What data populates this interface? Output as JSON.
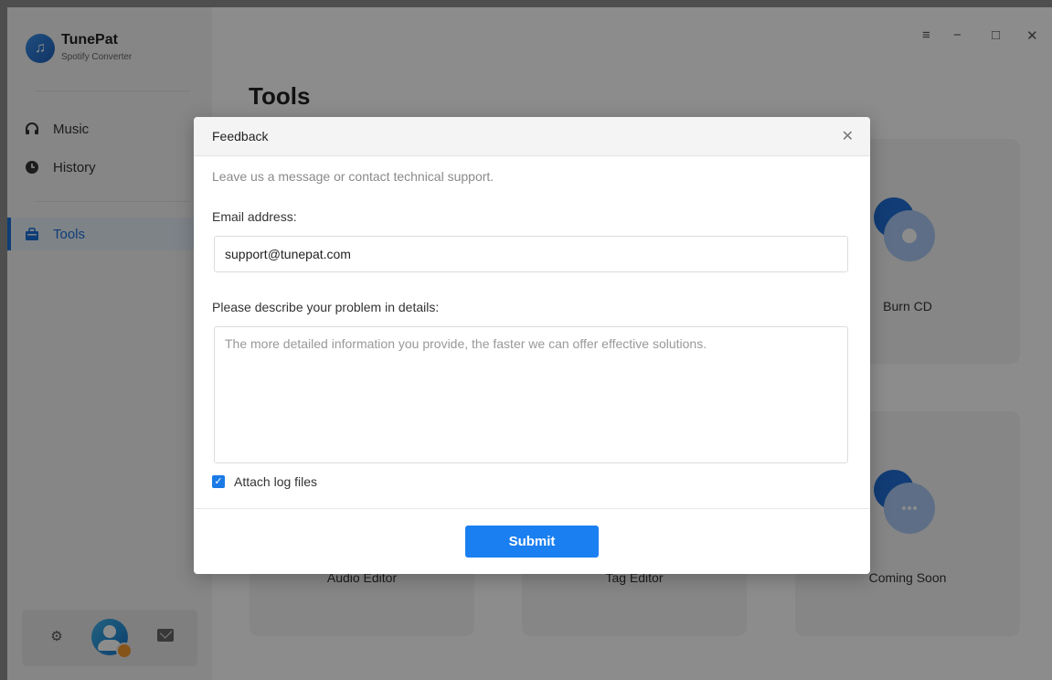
{
  "app": {
    "name": "TunePat",
    "subtitle": "Spotify Converter"
  },
  "sidebar": {
    "items": [
      {
        "label": "Music",
        "icon": "headphones-icon"
      },
      {
        "label": "History",
        "icon": "clock-icon"
      },
      {
        "label": "Tools",
        "icon": "toolbox-icon",
        "active": true
      }
    ]
  },
  "window_controls": {
    "menu": "≡",
    "minimize": "−",
    "maximize": "□",
    "close": "✕"
  },
  "main": {
    "title": "Tools",
    "cards": [
      {
        "label": "Audio Editor"
      },
      {
        "label": "Tag Editor"
      },
      {
        "label": "Burn CD"
      },
      {
        "label": "Coming Soon"
      }
    ]
  },
  "modal": {
    "title": "Feedback",
    "close": "✕",
    "description": "Leave us a message or contact technical support.",
    "email_label": "Email address:",
    "email_value": "support@tunepat.com",
    "problem_label": "Please describe your problem in details:",
    "problem_placeholder": "The more detailed information you provide, the faster we can offer effective solutions.",
    "attach_label": "Attach log files",
    "attach_checked": true,
    "submit_label": "Submit"
  },
  "colors": {
    "accent": "#1a7ff0",
    "active_nav": "#1b6fd8"
  }
}
